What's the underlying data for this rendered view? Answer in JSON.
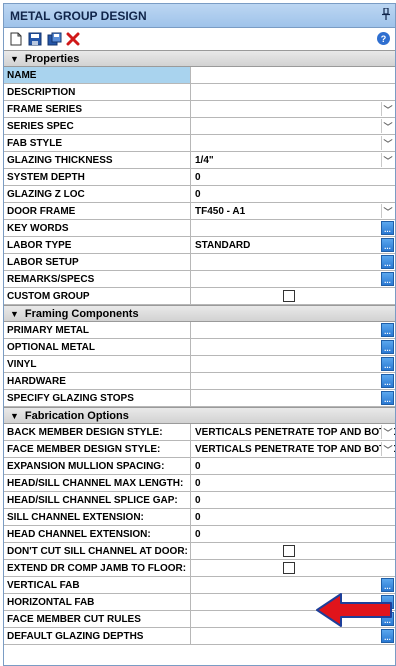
{
  "window": {
    "title": "METAL GROUP DESIGN",
    "pin": "ꟷ"
  },
  "toolbar": {
    "help": "?"
  },
  "sections": {
    "properties": {
      "title": "Properties",
      "rows": [
        {
          "label": "NAME",
          "value": ""
        },
        {
          "label": "DESCRIPTION",
          "value": ""
        },
        {
          "label": "FRAME SERIES",
          "value": ""
        },
        {
          "label": "SERIES SPEC",
          "value": ""
        },
        {
          "label": "FAB STYLE",
          "value": ""
        },
        {
          "label": "GLAZING THICKNESS",
          "value": "1/4\""
        },
        {
          "label": "SYSTEM DEPTH",
          "value": "0"
        },
        {
          "label": "GLAZING Z LOC",
          "value": "0"
        },
        {
          "label": "DOOR FRAME",
          "value": "TF450 - A1"
        },
        {
          "label": "KEY WORDS",
          "value": ""
        },
        {
          "label": "LABOR TYPE",
          "value": "STANDARD"
        },
        {
          "label": "LABOR SETUP",
          "value": ""
        },
        {
          "label": "REMARKS/SPECS",
          "value": ""
        },
        {
          "label": "CUSTOM GROUP",
          "value": ""
        }
      ]
    },
    "framing": {
      "title": "Framing Components",
      "rows": [
        {
          "label": "PRIMARY METAL",
          "value": ""
        },
        {
          "label": "OPTIONAL METAL",
          "value": ""
        },
        {
          "label": "VINYL",
          "value": ""
        },
        {
          "label": "HARDWARE",
          "value": ""
        },
        {
          "label": "SPECIFY GLAZING STOPS",
          "value": ""
        }
      ]
    },
    "fabrication": {
      "title": "Fabrication Options",
      "rows": [
        {
          "label": "BACK MEMBER DESIGN STYLE:",
          "value": "VERTICALS PENETRATE TOP AND BOTTOM"
        },
        {
          "label": "FACE MEMBER DESIGN STYLE:",
          "value": "VERTICALS PENETRATE TOP AND BOTTOM"
        },
        {
          "label": "EXPANSION MULLION SPACING:",
          "value": "0"
        },
        {
          "label": "HEAD/SILL CHANNEL MAX LENGTH:",
          "value": "0"
        },
        {
          "label": "HEAD/SILL CHANNEL SPLICE GAP:",
          "value": "0"
        },
        {
          "label": "SILL CHANNEL EXTENSION:",
          "value": "0"
        },
        {
          "label": "HEAD CHANNEL EXTENSION:",
          "value": "0"
        },
        {
          "label": "DON'T CUT SILL CHANNEL AT DOOR:",
          "value": ""
        },
        {
          "label": "EXTEND DR COMP JAMB TO FLOOR:",
          "value": ""
        },
        {
          "label": "VERTICAL FAB",
          "value": ""
        },
        {
          "label": "HORIZONTAL FAB",
          "value": ""
        },
        {
          "label": "FACE MEMBER CUT RULES",
          "value": ""
        },
        {
          "label": "DEFAULT GLAZING DEPTHS",
          "value": ""
        }
      ]
    }
  },
  "colors": {
    "selection": "#a9d3ee",
    "annotation_arrow": "#e0141b",
    "header": "#9fc3ea"
  }
}
